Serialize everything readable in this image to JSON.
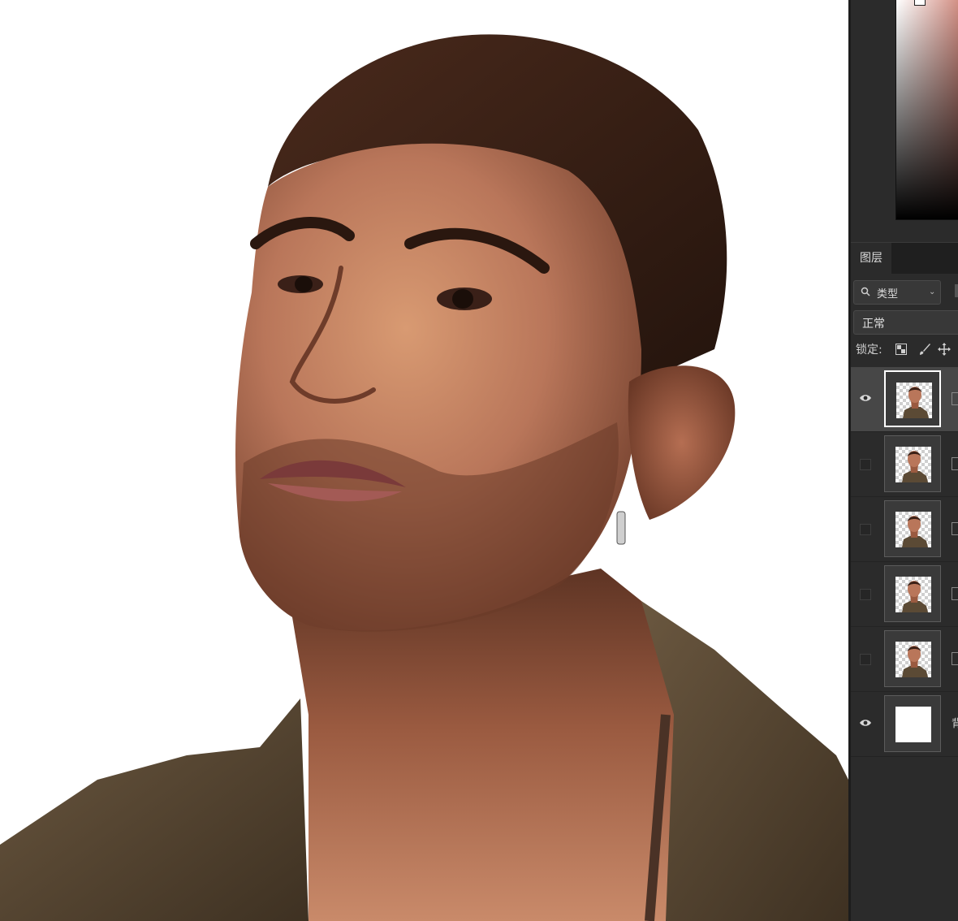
{
  "canvas": {
    "artwork": "digital-painting-portrait",
    "colors": {
      "skin": "#b9765a",
      "skin_shadow": "#7a4632",
      "hair": "#3a2016",
      "jacket": "#5b4a35",
      "background": "#ffffff"
    }
  },
  "color_picker": {
    "hue_color": "#d28f84"
  },
  "layers_panel": {
    "tab_label": "图层",
    "filter": {
      "label": "类型",
      "icon": "search-icon"
    },
    "blend_mode": "正常",
    "lock_label": "锁定:",
    "layers": [
      {
        "visible": true,
        "selected": true,
        "thumb": "portrait"
      },
      {
        "visible": false,
        "selected": false,
        "thumb": "portrait"
      },
      {
        "visible": false,
        "selected": false,
        "thumb": "portrait"
      },
      {
        "visible": false,
        "selected": false,
        "thumb": "portrait"
      },
      {
        "visible": false,
        "selected": false,
        "thumb": "portrait"
      },
      {
        "visible": true,
        "selected": false,
        "thumb": "white",
        "name": "背"
      }
    ]
  }
}
